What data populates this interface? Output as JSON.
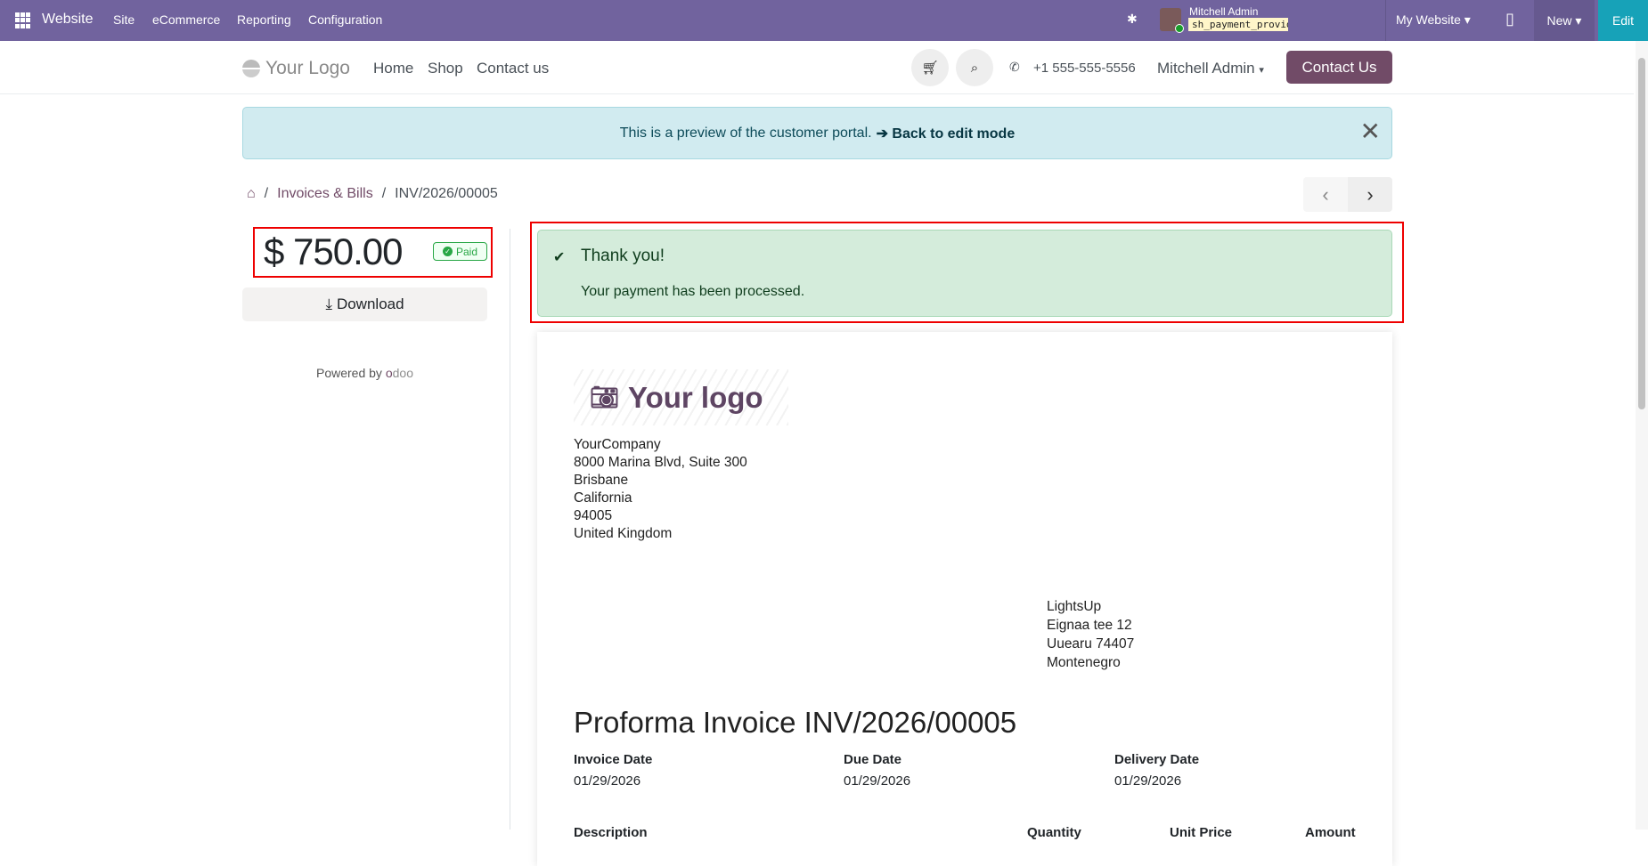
{
  "topbar": {
    "app": "Website",
    "menu": [
      "Site",
      "eCommerce",
      "Reporting",
      "Configuration"
    ],
    "user": "Mitchell Admin",
    "db": "sh_payment_provider_hype…",
    "my_website": "My Website",
    "new": "New",
    "edit": "Edit"
  },
  "header": {
    "logo": "Your Logo",
    "nav": [
      "Home",
      "Shop",
      "Contact us"
    ],
    "phone": "+1 555-555-5556",
    "user": "Mitchell Admin",
    "contact_btn": "Contact Us"
  },
  "preview": {
    "text": "This is a preview of the customer portal.",
    "link": "➔ Back to edit mode"
  },
  "breadcrumb": {
    "items": [
      "Invoices & Bills",
      "INV/2026/00005"
    ]
  },
  "sidebar": {
    "amount": "$ 750.00",
    "status": "Paid",
    "download": "Download",
    "powered_by": "Powered by",
    "odoo": "odoo"
  },
  "alert": {
    "title": "Thank you!",
    "message": "Your payment has been processed."
  },
  "invoice": {
    "logo_text": "Your logo",
    "company": [
      "YourCompany",
      "8000 Marina Blvd, Suite 300",
      "Brisbane",
      "California",
      "94005",
      "United Kingdom"
    ],
    "customer": [
      "LightsUp",
      "Eignaa tee 12",
      "Uuearu 74407",
      "Montenegro"
    ],
    "title": "Proforma Invoice INV/2026/00005",
    "dates": [
      {
        "label": "Invoice Date",
        "value": "01/29/2026"
      },
      {
        "label": "Due Date",
        "value": "01/29/2026"
      },
      {
        "label": "Delivery Date",
        "value": "01/29/2026"
      }
    ],
    "columns": [
      "Description",
      "Quantity",
      "Unit Price",
      "Amount"
    ]
  }
}
